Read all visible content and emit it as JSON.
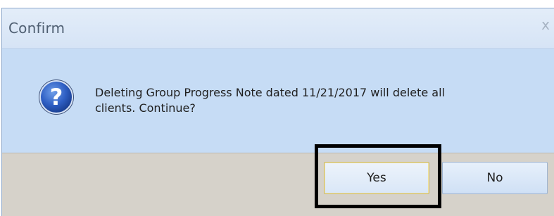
{
  "dialog": {
    "title": "Confirm",
    "close_glyph": "x",
    "icon": "question-icon",
    "message_line1": "Deleting Group Progress Note dated 11/21/2017 will delete all",
    "message_line2": "clients. Continue?",
    "buttons": {
      "yes_label": "Yes",
      "no_label": "No"
    },
    "colors": {
      "highlight_box": "#000000",
      "content_bg": "#c6dcf5",
      "footer_bg": "#d6d2ca"
    }
  }
}
